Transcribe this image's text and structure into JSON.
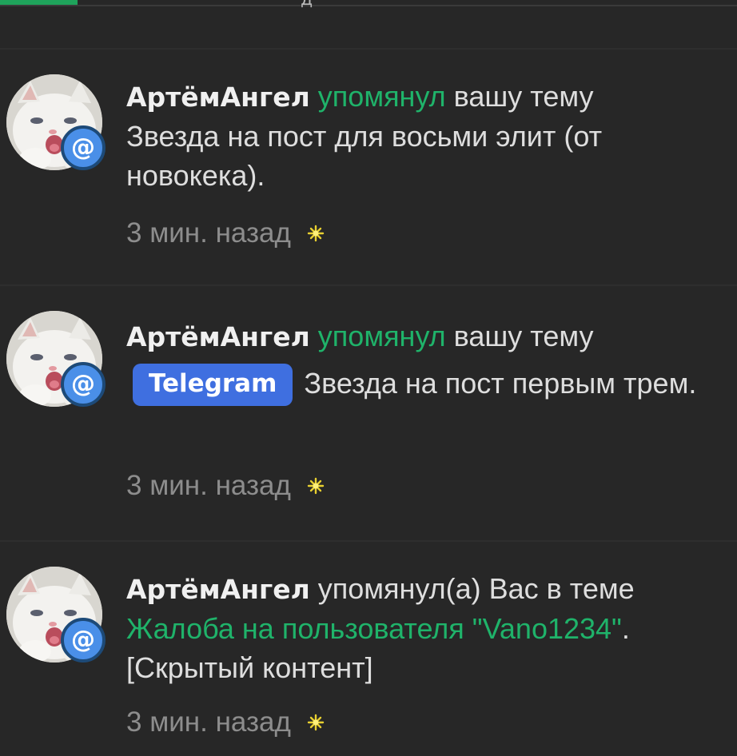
{
  "top": {
    "glyph": "д"
  },
  "notifications": [
    {
      "author": "АртёмАнгел",
      "action": "упомянул",
      "action_suffix": " вашу тему",
      "tag": "",
      "thread": "Звезда на пост для восьми элит (от новокека).",
      "time": "3 мин. назад",
      "badge": "@"
    },
    {
      "author": "АртёмАнгел",
      "action": "упомянул",
      "action_suffix": " вашу тему",
      "tag": "Telegram",
      "thread": "Звезда на пост первым трем.",
      "time": "3 мин. назад",
      "badge": "@"
    },
    {
      "author": "АртёмАнгел",
      "action": " упомянул(а) Вас в теме",
      "thread_link": "Жалоба на пользователя \"Vano1234\"",
      "thread_end": ".",
      "hidden": "[Скрытый контент]",
      "time": "3 мин. назад",
      "badge": "@"
    }
  ],
  "colors": {
    "background": "#272727",
    "accent_green": "#1fb36a",
    "tag_blue": "#3f6fe0",
    "badge_blue": "#4a8fe8",
    "text": "#dedede",
    "muted": "#8d8d8d"
  },
  "icons": {
    "avatar": "white-kitten-avatar",
    "badge": "mention-at-icon",
    "unread": "sparkle-star-icon"
  }
}
